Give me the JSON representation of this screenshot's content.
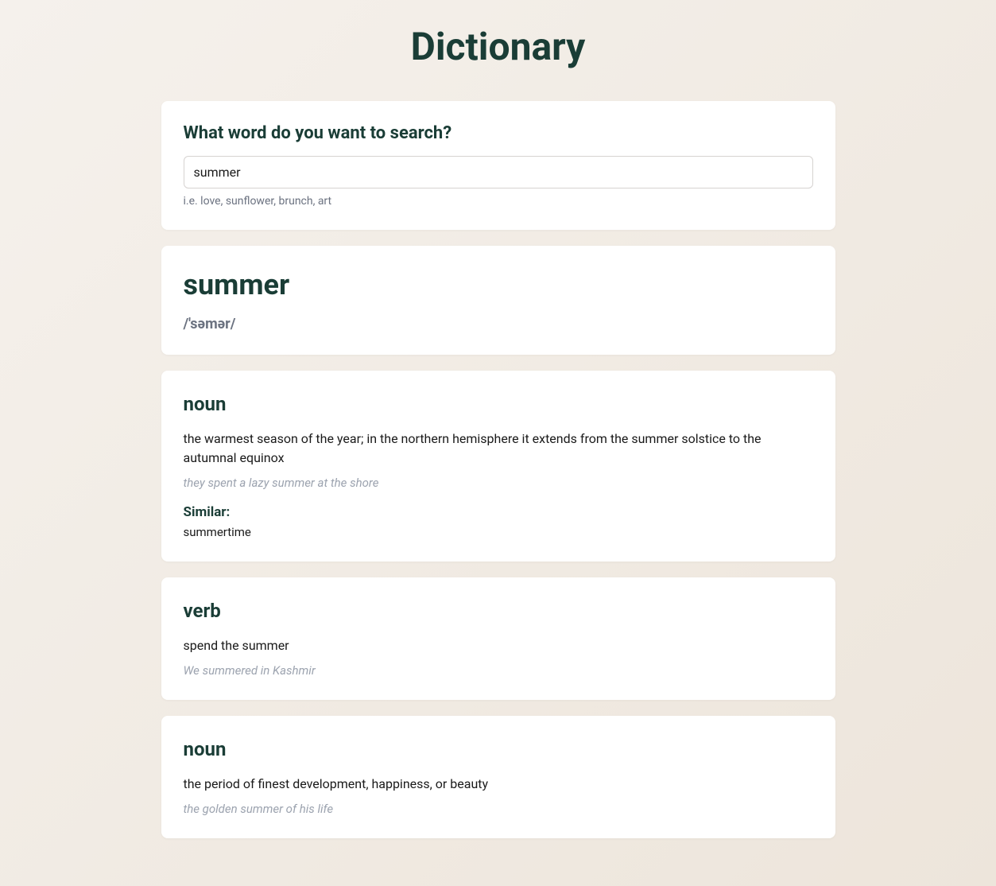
{
  "page": {
    "title": "Dictionary"
  },
  "search": {
    "heading": "What word do you want to search?",
    "value": "summer",
    "hint": "i.e. love, sunflower, brunch, art"
  },
  "result": {
    "word": "summer",
    "phonetic": "/'səmər/"
  },
  "definitions": [
    {
      "pos": "noun",
      "text": "the warmest season of the year; in the northern hemisphere it extends from the summer solstice to the autumnal equinox",
      "example": "they spent a lazy summer at the shore",
      "similar_label": "Similar:",
      "similar": "summertime"
    },
    {
      "pos": "verb",
      "text": "spend the summer",
      "example": "We summered in Kashmir"
    },
    {
      "pos": "noun",
      "text": "the period of finest development, happiness, or beauty",
      "example": "the golden summer of his life"
    }
  ]
}
